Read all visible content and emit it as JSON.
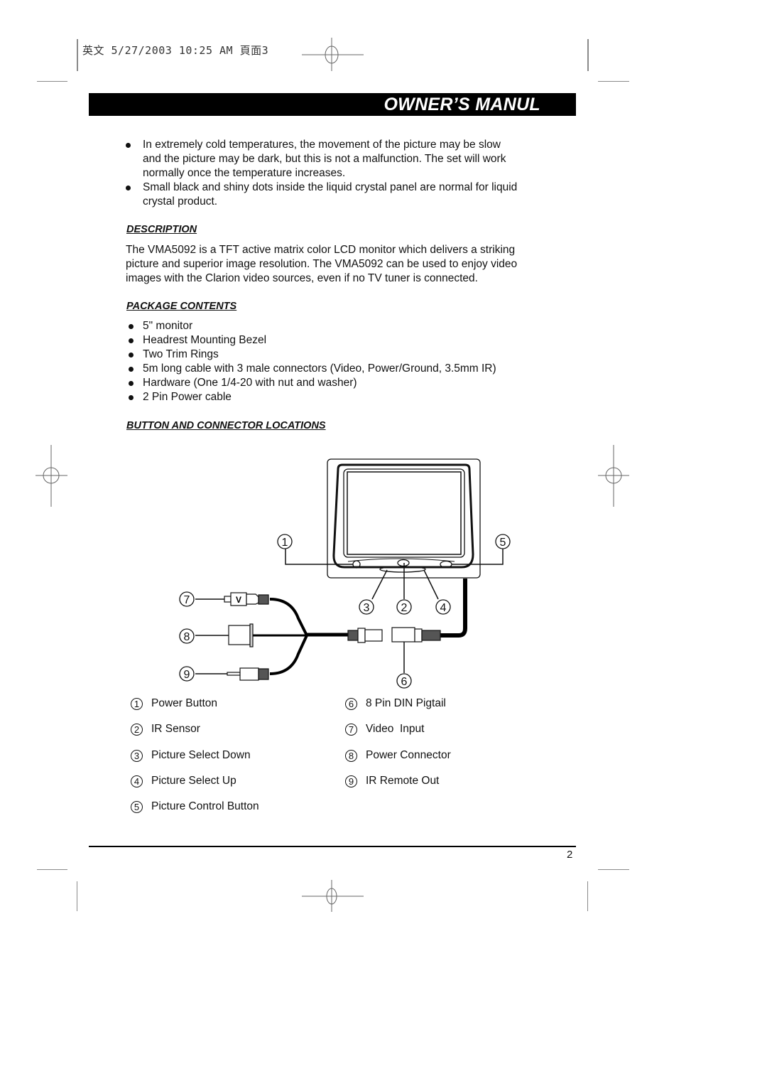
{
  "print_stamp": "英文 5/27/2003 10:25 AM 頁面3",
  "header": {
    "title": "OWNER’S MANUL"
  },
  "notes": [
    {
      "lines": [
        "In extremely cold temperatures, the movement of the picture may be slow",
        "and the picture may be dark, but this is not a malfunction.  The set will work",
        "normally once the temperature increases."
      ]
    },
    {
      "lines": [
        "Small black and shiny dots inside the liquid crystal panel are normal for liquid",
        "crystal product."
      ]
    }
  ],
  "description": {
    "heading": "DESCRIPTION",
    "lines": [
      "The VMA5092 is a TFT active matrix color LCD monitor which delivers a striking",
      "picture and superior image resolution.  The VMA5092 can be used to enjoy video",
      "images with the Clarion video sources, even if no TV tuner is connected."
    ]
  },
  "package_contents": {
    "heading": "PACKAGE CONTENTS",
    "items": [
      "5\" monitor",
      "Headrest Mounting Bezel",
      "Two Trim Rings",
      "5m long cable with 3 male connectors (Video, Power/Ground, 3.5mm IR)",
      "Hardware (One 1/4-20 with nut and washer)",
      "2 Pin Power cable"
    ]
  },
  "locations": {
    "heading": "BUTTON AND CONNECTOR LOCATIONS",
    "diagram_callouts": [
      "1",
      "2",
      "3",
      "4",
      "5",
      "6",
      "7",
      "8",
      "9"
    ],
    "connector_label": "V",
    "legend_left": [
      {
        "num": "1",
        "label": "Power Button"
      },
      {
        "num": "2",
        "label": "IR Sensor"
      },
      {
        "num": "3",
        "label": "Picture Select Down"
      },
      {
        "num": "4",
        "label": "Picture Select Up"
      },
      {
        "num": "5",
        "label": "Picture Control Button"
      }
    ],
    "legend_right": [
      {
        "num": "6",
        "label": "8 Pin DIN Pigtail"
      },
      {
        "num": "7",
        "label": "Video  Input"
      },
      {
        "num": "8",
        "label": "Power Connector"
      },
      {
        "num": "9",
        "label": "IR Remote Out"
      }
    ]
  },
  "footer": {
    "page_number": "2"
  }
}
